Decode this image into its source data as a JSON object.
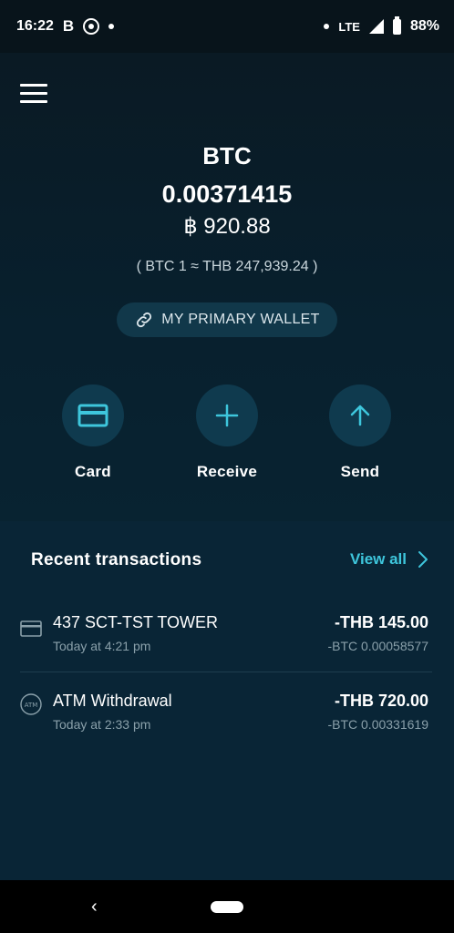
{
  "status_bar": {
    "time": "16:22",
    "b_label": "B",
    "network": "LTE",
    "battery": "88%"
  },
  "wallet": {
    "currency": "BTC",
    "balance": "0.00371415",
    "fiat_balance": "฿ 920.88",
    "rate": "( BTC 1 ≈ THB 247,939.24 )",
    "wallet_name": "MY PRIMARY WALLET"
  },
  "actions": [
    {
      "label": "Card",
      "icon": "card-icon"
    },
    {
      "label": "Receive",
      "icon": "plus-icon"
    },
    {
      "label": "Send",
      "icon": "arrow-up-icon"
    }
  ],
  "transactions": {
    "heading": "Recent transactions",
    "view_all": "View all",
    "items": [
      {
        "name": "437 SCT-TST TOWER",
        "time": "Today at 4:21 pm",
        "amount": "-THB 145.00",
        "btc": "-BTC 0.00058577",
        "icon": "card-icon"
      },
      {
        "name": "ATM Withdrawal",
        "time": "Today at 2:33 pm",
        "amount": "-THB 720.00",
        "btc": "-BTC 0.00331619",
        "icon": "atm-icon",
        "icon_text": "ATM"
      }
    ]
  },
  "colors": {
    "accent": "#3ec6dc",
    "header_bg": "#0a1a24",
    "tx_bg": "#092536"
  }
}
